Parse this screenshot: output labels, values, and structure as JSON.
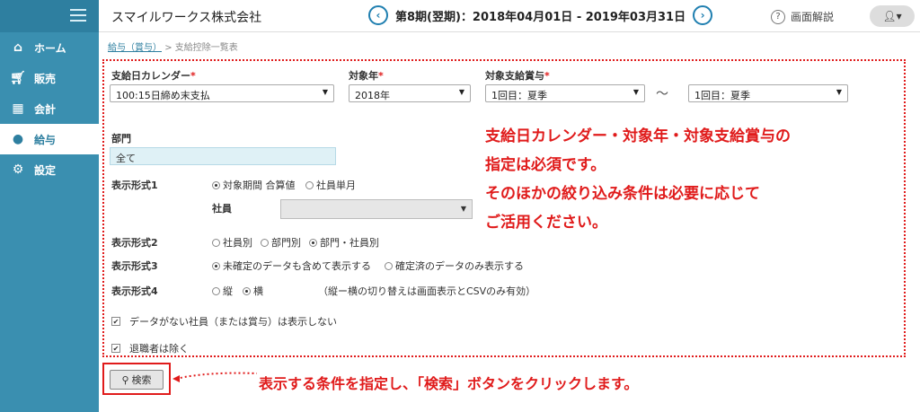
{
  "sidebar": {
    "items": [
      {
        "label": "ホーム",
        "icon": "home-icon"
      },
      {
        "label": "販売",
        "icon": "cart-icon"
      },
      {
        "label": "会計",
        "icon": "calculator-icon"
      },
      {
        "label": "給与",
        "icon": "money-bag-icon"
      },
      {
        "label": "設定",
        "icon": "gear-icon"
      }
    ]
  },
  "header": {
    "company": "スマイルワークス株式会社",
    "period": "第8期(翌期)：2018年04月01日 - 2019年03月31日",
    "prev": "‹",
    "next": "›",
    "help_label": "画面解説"
  },
  "breadcrumb": {
    "parent": "給与（賞与）",
    "separator": ">",
    "current": "支給控除一覧表"
  },
  "form": {
    "calendar_label": "支給日カレンダー",
    "calendar_value": "100:15日締め末支払",
    "year_label": "対象年",
    "year_value": "2018年",
    "bonus_label": "対象支給賞与",
    "bonus_from": "1回目：夏季",
    "bonus_tilde": "～",
    "bonus_to": "1回目：夏季",
    "required_mark": "*",
    "dept_label": "部門",
    "dept_value": "全て",
    "format1_label": "表示形式1",
    "format1_opt1": "対象期間 合算値",
    "format1_opt2": "社員単月",
    "employee_label": "社員",
    "format2_label": "表示形式2",
    "format2_opt1": "社員別",
    "format2_opt2": "部門別",
    "format2_opt3": "部門・社員別",
    "format3_label": "表示形式3",
    "format3_opt1": "未確定のデータも含めて表示する",
    "format3_opt2": "確定済のデータのみ表示する",
    "format4_label": "表示形式4",
    "format4_opt1": "縦",
    "format4_opt2": "横",
    "format4_note": "（縦ー横の切り替えは画面表示とCSVのみ有効）",
    "check1": "データがない社員（または賞与）は表示しない",
    "check2": "退職者は除く"
  },
  "search_label": "検索",
  "annotation": {
    "line1": "支給日カレンダー・対象年・対象支給賞与の",
    "line2": "指定は必須です。",
    "line3": "そのほかの絞り込み条件は必要に応じて",
    "line4": "ご活用ください。",
    "bottom": "表示する条件を指定し、「検索」ボタンをクリックします。"
  },
  "colors": {
    "sidebar": "#3a8fb0",
    "accent": "#1f7fb0",
    "annotation": "#e01b1b"
  }
}
